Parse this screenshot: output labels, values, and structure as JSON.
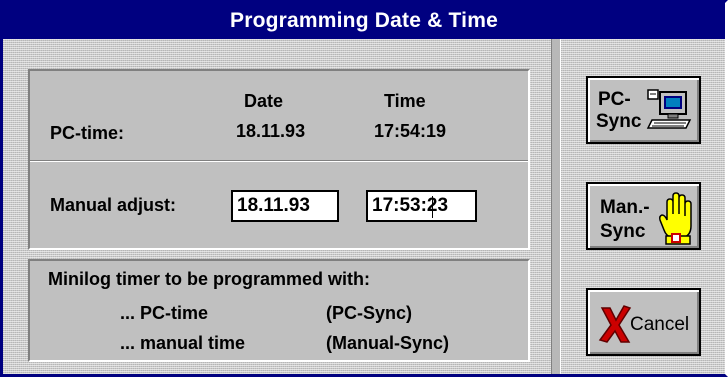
{
  "window": {
    "title": "Programming Date & Time"
  },
  "pc_time": {
    "label": "PC-time:",
    "date_header": "Date",
    "time_header": "Time",
    "date": "18.11.93",
    "time": "17:54:19"
  },
  "manual_adjust": {
    "label": "Manual adjust:",
    "date_value": "18.11.93",
    "time_value": "17:53:23"
  },
  "info": {
    "heading": "Minilog timer to be programmed with:",
    "rows": [
      {
        "what": "... PC-time",
        "how": "(PC-Sync)"
      },
      {
        "what": "... manual time",
        "how": "(Manual-Sync)"
      }
    ]
  },
  "buttons": {
    "pc_sync": {
      "line1": "PC-",
      "line2": "Sync",
      "icon": "computer-icon"
    },
    "man_sync": {
      "line1": "Man.-",
      "line2": "Sync",
      "icon": "hand-icon"
    },
    "cancel": {
      "label": "Cancel",
      "icon": "red-x-icon"
    }
  }
}
